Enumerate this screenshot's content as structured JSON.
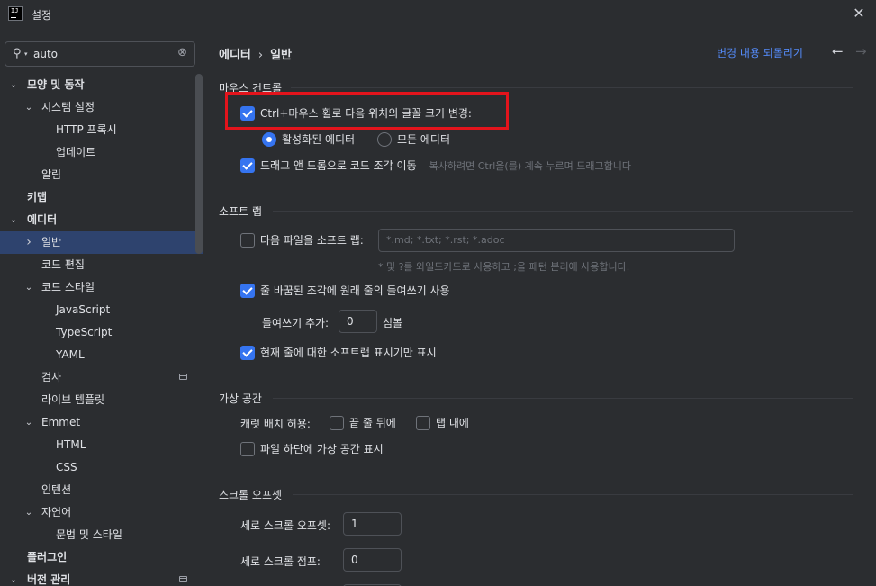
{
  "window": {
    "title": "설정",
    "logo_text": "IJ"
  },
  "search": {
    "value": "auto"
  },
  "sidebar": {
    "items": [
      {
        "label": "모양 및 동작",
        "level": 0,
        "arrow": "down",
        "bold": true
      },
      {
        "label": "시스템 설정",
        "level": 1,
        "arrow": "down"
      },
      {
        "label": "HTTP 프록시",
        "level": 2
      },
      {
        "label": "업데이트",
        "level": 2
      },
      {
        "label": "알림",
        "level": 1
      },
      {
        "label": "키맵",
        "level": 0,
        "bold": true
      },
      {
        "label": "에디터",
        "level": 0,
        "arrow": "down",
        "bold": true
      },
      {
        "label": "일반",
        "level": 1,
        "arrow": "right",
        "selected": true
      },
      {
        "label": "코드 편집",
        "level": 1
      },
      {
        "label": "코드 스타일",
        "level": 1,
        "arrow": "down"
      },
      {
        "label": "JavaScript",
        "level": 2
      },
      {
        "label": "TypeScript",
        "level": 2
      },
      {
        "label": "YAML",
        "level": 2
      },
      {
        "label": "검사",
        "level": 1,
        "badge": true
      },
      {
        "label": "라이브 템플릿",
        "level": 1
      },
      {
        "label": "Emmet",
        "level": 1,
        "arrow": "down"
      },
      {
        "label": "HTML",
        "level": 2
      },
      {
        "label": "CSS",
        "level": 2
      },
      {
        "label": "인텐션",
        "level": 1
      },
      {
        "label": "자연어",
        "level": 1,
        "arrow": "down"
      },
      {
        "label": "문법 및 스타일",
        "level": 2
      },
      {
        "label": "플러그인",
        "level": 0,
        "bold": true
      },
      {
        "label": "버전 관리",
        "level": 0,
        "arrow": "down",
        "bold": true,
        "badge": true
      }
    ]
  },
  "header": {
    "crumb_parent": "에디터",
    "crumb_current": "일반",
    "reset_label": "변경 내용 되돌리기"
  },
  "mouse": {
    "title": "마우스 컨트롤",
    "ctrl_wheel_label": "Ctrl+마우스 휠로 다음 위치의 글꼴 크기 변경:",
    "ctrl_wheel_checked": true,
    "radio_active": "활성화된 에디터",
    "radio_all": "모든 에디터",
    "dnd_label": "드래그 앤 드롭으로 코드 조각 이동",
    "dnd_checked": true,
    "dnd_hint": "복사하려면 Ctrl을(를) 계속 누르며 드래그합니다"
  },
  "softwrap": {
    "title": "소프트 랩",
    "files_label": "다음 파일을 소프트 랩:",
    "files_checked": false,
    "files_placeholder": "*.md; *.txt; *.rst; *.adoc",
    "files_hint": "* 및 ?를 와일드카드로 사용하고 ;을 패턴 분리에 사용합니다.",
    "indent_label": "줄 바꿈된 조각에 원래 줄의 들여쓰기 사용",
    "indent_checked": true,
    "indent_add_label": "들여쓰기 추가:",
    "indent_add_value": "0",
    "indent_unit": "심볼",
    "current_line_label": "현재 줄에 대한 소프트랩 표시기만 표시",
    "current_line_checked": true
  },
  "virtual": {
    "title": "가상 공간",
    "caret_label": "캐럿 배치 허용:",
    "end_of_line": "끝 줄 뒤에",
    "inside_tabs": "탭 내에",
    "bottom_label": "파일 하단에 가상 공간 표시"
  },
  "scroll": {
    "title": "스크롤 오프셋",
    "v_offset_label": "세로 스크롤 오프셋:",
    "v_offset_value": "1",
    "v_jump_label": "세로 스크롤 점프:",
    "v_jump_value": "0"
  },
  "colors": {
    "accent": "#3574f0",
    "selection": "#2e436e",
    "link": "#548af7",
    "highlight": "#e3141c"
  }
}
